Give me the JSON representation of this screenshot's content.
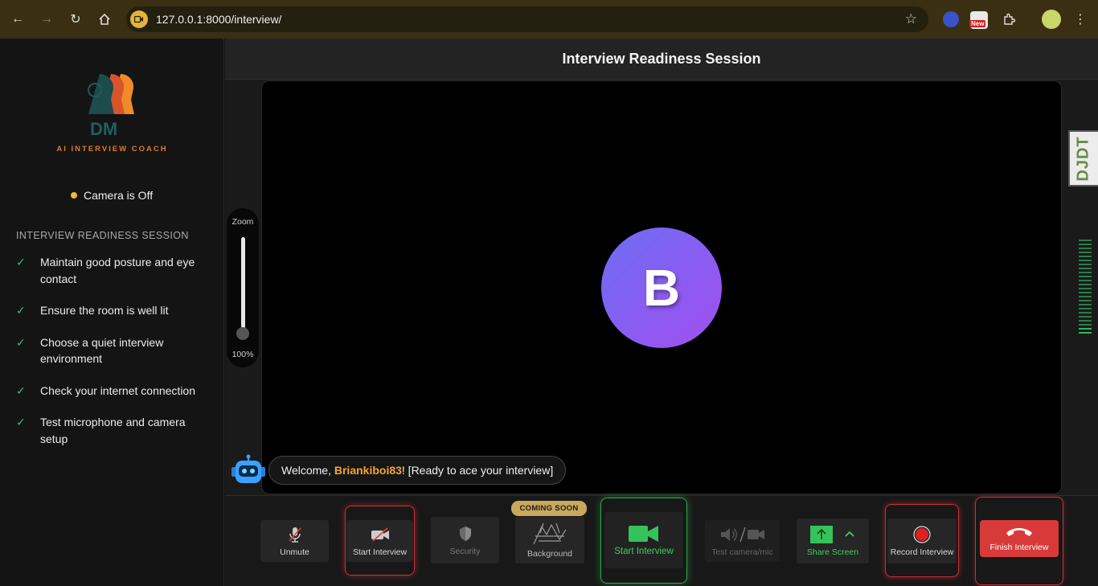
{
  "browser": {
    "url": "127.0.0.1:8000/interview/",
    "badge_new": "New"
  },
  "sidebar": {
    "logo_initials": "DM",
    "logo_subtitle": "AI INTERVIEW COACH",
    "camera_status": "Camera is Off",
    "section_title": "INTERVIEW READINESS SESSION",
    "tips": [
      "Maintain good posture and eye contact",
      "Ensure the room is well lit",
      "Choose a quiet interview environment",
      "Check your internet connection",
      "Test microphone and camera setup"
    ]
  },
  "header": {
    "title": "Interview Readiness Session"
  },
  "video": {
    "avatar_letter": "B",
    "zoom_label": "Zoom",
    "zoom_value": "100%",
    "djdt_label": "DJDT"
  },
  "welcome": {
    "prefix": "Welcome, ",
    "username": "Briankiboi83",
    "suffix": "! [Ready to ace your interview]"
  },
  "controls": {
    "unmute": "Unmute",
    "start_interview_cam": "Start Interview",
    "security": "Security",
    "coming_soon": "COMING SOON",
    "background": "Background",
    "start_interview": "Start Interview",
    "test_camera": "Test camera/mic",
    "share_screen": "Share Screen",
    "record": "Record Interview",
    "finish": "Finish Interview"
  },
  "colors": {
    "accent_orange": "#f3a531",
    "success_green": "#2aa84a",
    "danger_red": "#d83a3a",
    "avatar_gradient": [
      "#6d6df2",
      "#a34ef0"
    ]
  }
}
